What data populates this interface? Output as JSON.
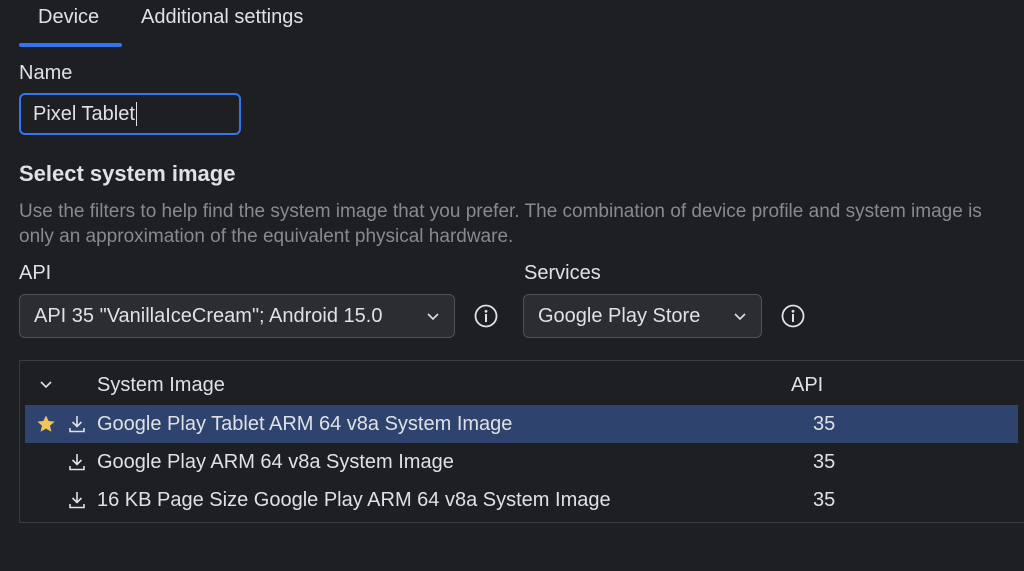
{
  "tabs": [
    {
      "label": "Device",
      "active": true
    },
    {
      "label": "Additional settings",
      "active": false
    }
  ],
  "name": {
    "label": "Name",
    "value": "Pixel Tablet"
  },
  "system_image": {
    "heading": "Select system image",
    "description": "Use the filters to help find the system image that you prefer. The combination of device profile and system image is only an approximation of the equivalent physical hardware."
  },
  "filters": {
    "api": {
      "label": "API",
      "selected": "API 35 \"VanillaIceCream\"; Android 15.0"
    },
    "services": {
      "label": "Services",
      "selected": "Google Play Store"
    }
  },
  "table": {
    "columns": [
      "System Image",
      "API"
    ],
    "rows": [
      {
        "name": "Google Play Tablet ARM 64 v8a System Image",
        "api": "35",
        "starred": true,
        "selected": true
      },
      {
        "name": "Google Play ARM 64 v8a System Image",
        "api": "35",
        "starred": false,
        "selected": false
      },
      {
        "name": "16 KB Page Size Google Play ARM 64 v8a System Image",
        "api": "35",
        "starred": false,
        "selected": false
      }
    ]
  },
  "colors": {
    "accent": "#3574f0",
    "selection": "#2e436e",
    "star": "#f2c55c",
    "background": "#1e1f22"
  }
}
